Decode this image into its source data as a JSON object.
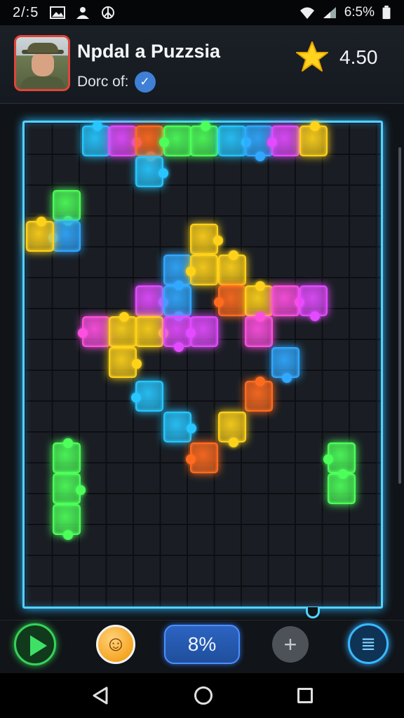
{
  "status": {
    "time": "2/:5",
    "battery": "6:5%",
    "icons": [
      "image-icon",
      "people-icon",
      "peace-icon",
      "wifi-icon",
      "signal-icon",
      "battery-icon"
    ]
  },
  "header": {
    "title": "Npdal a Puzzsia",
    "subtitle": "Dorc of:",
    "score": "4.50",
    "icons": [
      "avatar",
      "check-icon",
      "star-icon"
    ]
  },
  "controls": {
    "progress_label": "8%",
    "add_label": "+",
    "emoji": "☺",
    "menu_icon": "≣",
    "icons": [
      "play-icon",
      "emoji-icon",
      "plus-icon",
      "menu-icon"
    ]
  },
  "nav": {
    "icons": [
      "back-icon",
      "home-icon",
      "recents-icon"
    ]
  },
  "colors": {
    "cyan": "#27c6ff",
    "magenta": "#e24bff",
    "orange": "#ff6b1f",
    "green": "#4dff5a",
    "yellow": "#ffd21a",
    "blue": "#31a8ff",
    "pink": "#ff4fe0",
    "border_glow": "#52d3ff"
  }
}
